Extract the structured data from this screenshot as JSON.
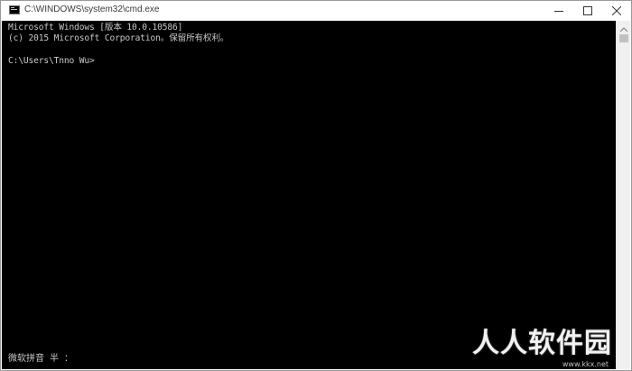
{
  "window": {
    "title": "C:\\WINDOWS\\system32\\cmd.exe",
    "icon": "cmd-icon",
    "controls": {
      "minimize": "minimize-icon",
      "maximize": "maximize-icon",
      "close": "close-icon"
    }
  },
  "console": {
    "lines": [
      "Microsoft Windows [版本 10.0.10586]",
      "(c) 2015 Microsoft Corporation。保留所有权利。",
      "",
      "C:\\Users\\Tnno Wu>"
    ],
    "ime_status": "微软拼音 半 ："
  },
  "watermark": {
    "text": "人人软件园",
    "url": "www.kkx.net"
  },
  "colors": {
    "console_bg": "#000000",
    "console_fg": "#c0c0c0",
    "titlebar_bg": "#ffffff"
  }
}
